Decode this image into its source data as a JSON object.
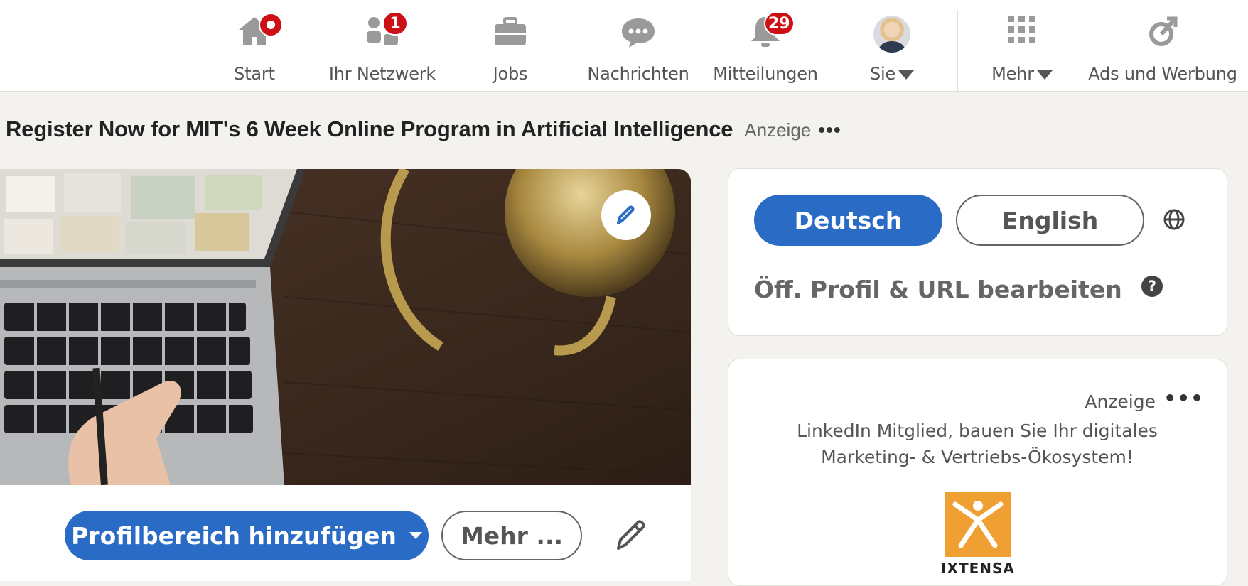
{
  "nav": {
    "items": [
      {
        "label": "Start",
        "icon": "home-icon",
        "badge": ""
      },
      {
        "label": "Ihr Netzwerk",
        "icon": "network-icon",
        "badge": "1"
      },
      {
        "label": "Jobs",
        "icon": "briefcase-icon",
        "badge": ""
      },
      {
        "label": "Nachrichten",
        "icon": "messaging-icon",
        "badge": ""
      },
      {
        "label": "Mitteilungen",
        "icon": "bell-icon",
        "badge": "29"
      },
      {
        "label": "Sie",
        "icon": "avatar",
        "badge": ""
      },
      {
        "label": "Mehr",
        "icon": "grid-icon",
        "badge": ""
      },
      {
        "label": "Ads und Werbung",
        "icon": "ads-icon",
        "badge": ""
      }
    ],
    "badge_color": "#cc1016"
  },
  "ad_banner": {
    "title": "Register Now for MIT's 6 Week Online Program in Artificial Intelligence",
    "tag": "Anzeige",
    "more": "•••"
  },
  "profile": {
    "add_section_label": "Profilbereich hinzufügen",
    "more_label": "Mehr ...",
    "accent": "#2a6bc6"
  },
  "language_card": {
    "active_language": "Deutsch",
    "other_language": "English",
    "profile_url_label": "Öff. Profil & URL bearbeiten",
    "help_label": "?"
  },
  "ad_card": {
    "tag": "Anzeige",
    "more": "•••",
    "text": "LinkedIn Mitglied, bauen Sie Ihr digitales Marketing- & Vertriebs-Ökosystem!",
    "logo_text": "IXTENSA"
  }
}
